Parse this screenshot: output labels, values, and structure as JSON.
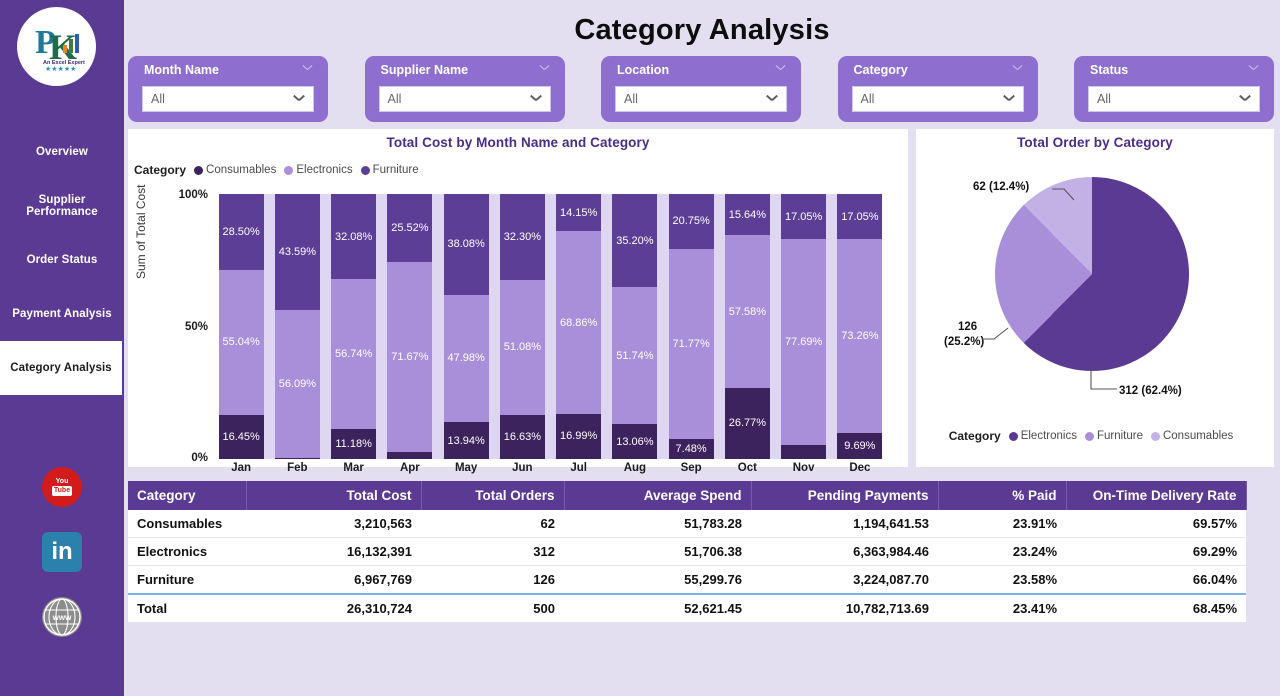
{
  "header": {
    "title": "Category Analysis"
  },
  "sidebar": {
    "logo": {
      "name": "pk-logo",
      "text": "PK",
      "tagline": "An Excel Expert"
    },
    "items": [
      {
        "label": "Overview",
        "active": false
      },
      {
        "label": "Supplier Performance",
        "active": false
      },
      {
        "label": "Order Status",
        "active": false
      },
      {
        "label": "Payment Analysis",
        "active": false
      },
      {
        "label": "Category Analysis",
        "active": true
      }
    ],
    "social": [
      {
        "name": "youtube-icon",
        "top": "You",
        "bottom": "Tube"
      },
      {
        "name": "linkedin-icon",
        "label": "in"
      },
      {
        "name": "website-icon",
        "label": "www"
      }
    ]
  },
  "slicers": [
    {
      "label": "Month Name",
      "value": "All",
      "placeholder": "All"
    },
    {
      "label": "Supplier Name",
      "value": "All",
      "placeholder": "All"
    },
    {
      "label": "Location",
      "value": "All",
      "placeholder": "All"
    },
    {
      "label": "Category",
      "value": "All",
      "placeholder": "All"
    },
    {
      "label": "Status",
      "value": "All",
      "placeholder": "All"
    }
  ],
  "colors": {
    "consumables": "#3c235e",
    "electronics": "#a98fd9",
    "furniture": "#5d3e96",
    "pie_consumables": "#c3b1e6",
    "pie_furniture": "#a98fd9",
    "pie_electronics": "#5b3a93",
    "sidebar": "#5b3a93",
    "page_bg": "#e3dff0",
    "slicer": "#8e6fd0",
    "title_accent": "#4a2d86"
  },
  "bar_card": {
    "title": "Total Cost by Month Name and Category"
  },
  "pie_card": {
    "title": "Total Order by Category"
  },
  "chart_data": [
    {
      "type": "bar",
      "subtype": "100% stacked",
      "title": "Total Cost by Month Name and Category",
      "xlabel": "Month Name",
      "ylabel": "Sum of Total Cost",
      "ylim": [
        0,
        100
      ],
      "yticks": [
        "0%",
        "50%",
        "100%"
      ],
      "legend_title": "Category",
      "legend_position": "top-left",
      "categories": [
        "Jan",
        "Feb",
        "Mar",
        "Apr",
        "May",
        "Jun",
        "Jul",
        "Aug",
        "Sep",
        "Oct",
        "Nov",
        "Dec"
      ],
      "series": [
        {
          "name": "Consumables",
          "color": "#3c235e",
          "values": [
            16.45,
            0.32,
            11.18,
            2.81,
            13.94,
            16.63,
            16.99,
            13.06,
            7.48,
            26.77,
            5.26,
            9.69
          ],
          "labels": [
            "16.45%",
            "",
            "11.18%",
            "",
            "13.94%",
            "16.63%",
            "16.99%",
            "13.06%",
            "7.48%",
            "26.77%",
            "",
            "9.69%"
          ]
        },
        {
          "name": "Electronics",
          "color": "#a98fd9",
          "values": [
            55.04,
            56.09,
            56.74,
            71.67,
            47.98,
            51.08,
            68.86,
            51.74,
            71.77,
            57.58,
            77.69,
            73.26
          ],
          "labels": [
            "55.04%",
            "56.09%",
            "56.74%",
            "71.67%",
            "47.98%",
            "51.08%",
            "68.86%",
            "51.74%",
            "71.77%",
            "57.58%",
            "77.69%",
            "73.26%"
          ]
        },
        {
          "name": "Furniture",
          "color": "#5d3e96",
          "values": [
            28.5,
            43.59,
            32.08,
            25.52,
            38.08,
            32.3,
            14.15,
            35.2,
            20.75,
            15.64,
            17.05,
            17.05
          ],
          "labels": [
            "28.50%",
            "43.59%",
            "32.08%",
            "25.52%",
            "38.08%",
            "32.30%",
            "14.15%",
            "35.20%",
            "20.75%",
            "15.64%",
            "17.05%",
            "17.05%"
          ]
        }
      ]
    },
    {
      "type": "pie",
      "title": "Total Order by Category",
      "legend_title": "Category",
      "legend_position": "bottom",
      "slices": [
        {
          "name": "Electronics",
          "value": 312,
          "percent": 62.4,
          "label": "312 (62.4%)",
          "color": "#5b3a93"
        },
        {
          "name": "Furniture",
          "value": 126,
          "percent": 25.2,
          "label": "126\n(25.2%)",
          "color": "#a98fd9"
        },
        {
          "name": "Consumables",
          "value": 62,
          "percent": 12.4,
          "label": "62 (12.4%)",
          "color": "#c3b1e6"
        }
      ],
      "labels": {
        "consumables": "62 (12.4%)",
        "furniture_line1": "126",
        "furniture_line2": "(25.2%)",
        "electronics": "312 (62.4%)"
      }
    }
  ],
  "table": {
    "columns": [
      "Category",
      "Total Cost",
      "Total Orders",
      "Average Spend",
      "Pending Payments",
      "% Paid",
      "On-Time Delivery Rate"
    ],
    "rows": [
      {
        "category": "Consumables",
        "total_cost": "3,210,563",
        "total_orders": "62",
        "average_spend": "51,783.28",
        "pending_payments": "1,194,641.53",
        "pct_paid": "23.91%",
        "on_time": "69.57%"
      },
      {
        "category": "Electronics",
        "total_cost": "16,132,391",
        "total_orders": "312",
        "average_spend": "51,706.38",
        "pending_payments": "6,363,984.46",
        "pct_paid": "23.24%",
        "on_time": "69.29%"
      },
      {
        "category": "Furniture",
        "total_cost": "6,967,769",
        "total_orders": "126",
        "average_spend": "55,299.76",
        "pending_payments": "3,224,087.70",
        "pct_paid": "23.58%",
        "on_time": "66.04%"
      }
    ],
    "total": {
      "category": "Total",
      "total_cost": "26,310,724",
      "total_orders": "500",
      "average_spend": "52,621.45",
      "pending_payments": "10,782,713.69",
      "pct_paid": "23.41%",
      "on_time": "68.45%"
    }
  }
}
